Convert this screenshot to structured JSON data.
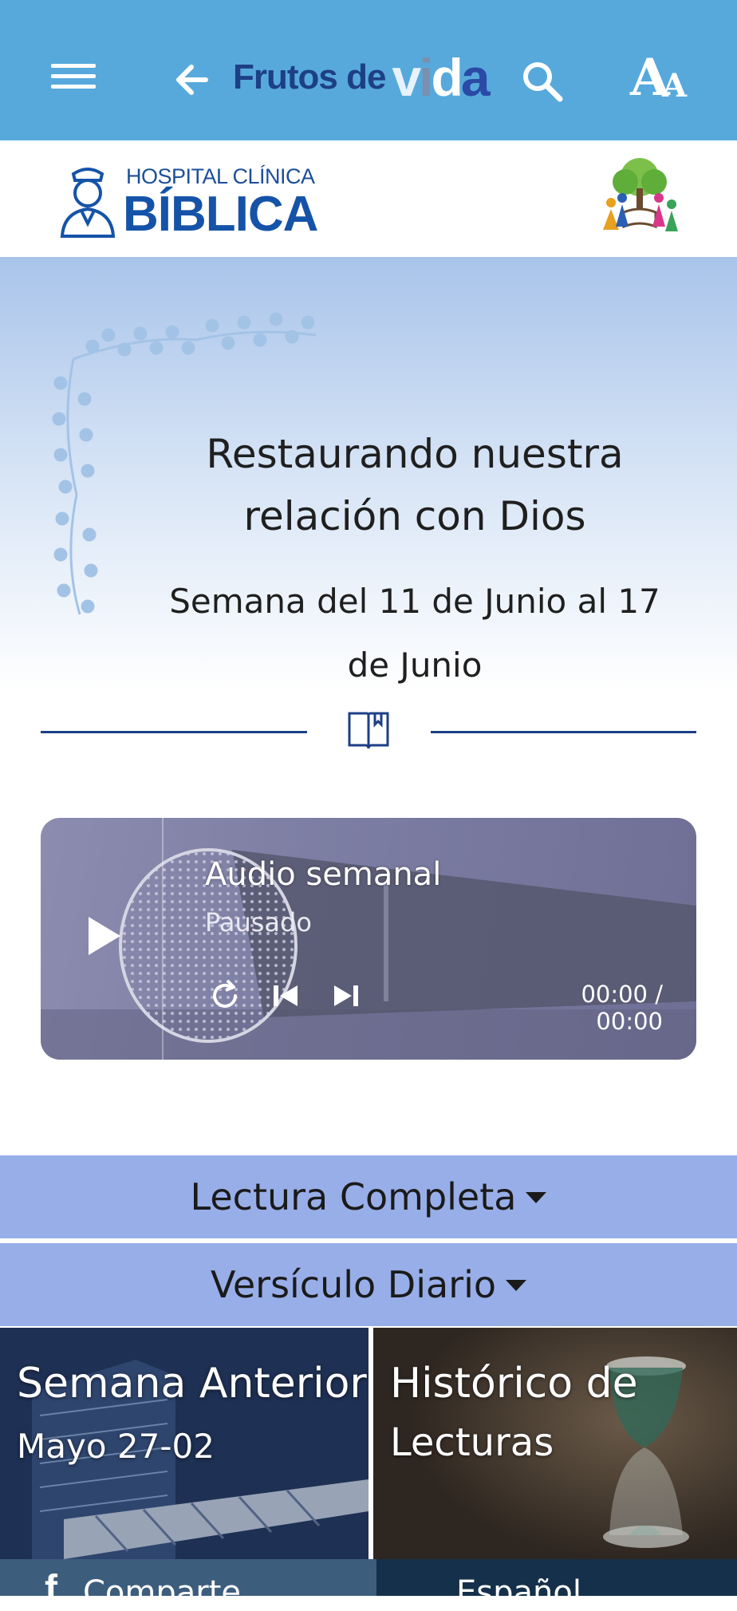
{
  "app_bar": {
    "logo_prefix": "Frutos de",
    "logo_word_parts": [
      "v",
      "i",
      "d",
      "a"
    ],
    "background_color": "#57a9dc",
    "icons": [
      "menu-icon",
      "back-arrow-icon",
      "search-icon",
      "font-size-icon"
    ],
    "font_size_big": "A",
    "font_size_small": "A"
  },
  "sponsor": {
    "hospital_line1": "HOSPITAL CLÍNICA",
    "hospital_line2": "BÍBLICA",
    "hospital_color": "#1553a8"
  },
  "hero": {
    "title": "Restaurando nuestra relación con Dios",
    "week": "Semana del 11 de Junio al 17 de Junio",
    "divider_icon": "open-book-icon",
    "accent_color": "#1d3f86"
  },
  "audio_player": {
    "title": "Audio semanal",
    "status": "Pausado",
    "time": "00:00 / 00:00",
    "controls": [
      "play-icon",
      "replay-icon",
      "skip-previous-icon",
      "skip-next-icon"
    ]
  },
  "accordions": [
    {
      "label": "Lectura Completa"
    },
    {
      "label": "Versículo Diario"
    }
  ],
  "accordion_color": "#98aee8",
  "tiles": [
    {
      "title": "Semana Anterior",
      "subtitle": "Mayo 27-02"
    },
    {
      "title": "Histórico de",
      "subtitle": "Lecturas"
    }
  ],
  "bottom_bar": {
    "left_label": "Comparte",
    "right_label": "Español",
    "left_icon": "facebook-icon"
  }
}
